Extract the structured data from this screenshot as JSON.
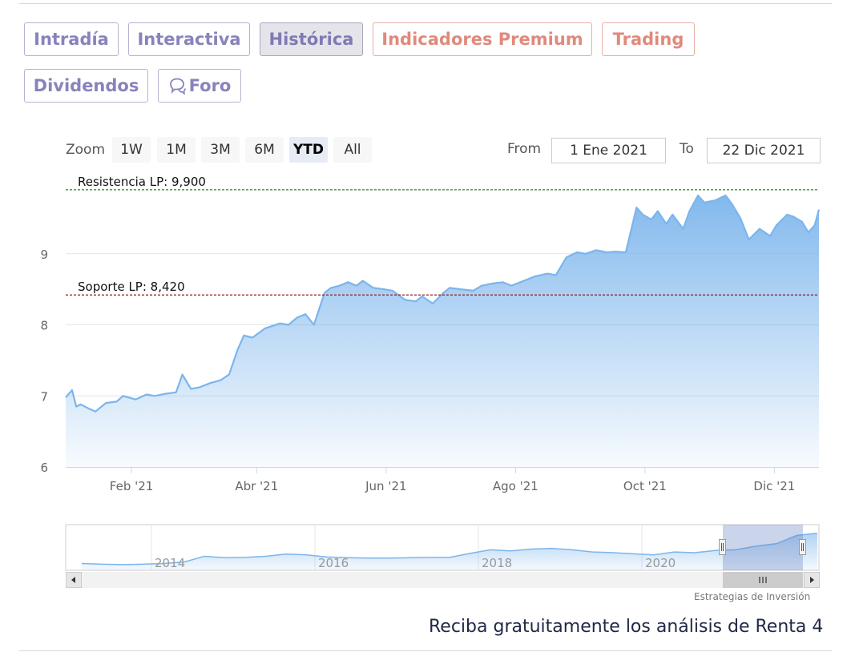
{
  "tabs": [
    {
      "label": "Intradía",
      "state": "normal"
    },
    {
      "label": "Interactiva",
      "state": "normal"
    },
    {
      "label": "Histórica",
      "state": "active"
    },
    {
      "label": "Indicadores Premium",
      "state": "premium"
    },
    {
      "label": "Trading",
      "state": "premium"
    },
    {
      "label": "Dividendos",
      "state": "normal"
    },
    {
      "label": "Foro",
      "state": "normal",
      "icon": "speech-bubbles-icon"
    }
  ],
  "range_selector": {
    "zoom_label": "Zoom",
    "buttons": [
      "1W",
      "1M",
      "3M",
      "6M",
      "YTD",
      "All"
    ],
    "selected": "YTD",
    "from_label": "From",
    "from_value": "1 Ene 2021",
    "to_label": "To",
    "to_value": "22 Dic 2021"
  },
  "chart_data": {
    "type": "area",
    "title": "",
    "x_tick_labels": [
      "Feb '21",
      "Abr '21",
      "Jun '21",
      "Ago '21",
      "Oct '21",
      "Dic '21"
    ],
    "y_tick_labels": [
      "6",
      "7",
      "8",
      "9"
    ],
    "ylim": [
      6,
      10
    ],
    "xlim": [
      "2021-01-01",
      "2021-12-22"
    ],
    "grid": true,
    "annotations": [
      {
        "label": "Resistencia LP: 9,900",
        "value": 9.9,
        "color": "#2e7d32",
        "style": "dashed"
      },
      {
        "label": "Soporte LP: 8,420",
        "value": 8.42,
        "color": "#8b1a1a",
        "style": "dashed"
      }
    ],
    "series": [
      {
        "color": "#7cb5ec",
        "x": [
          "2021-01-01",
          "2021-01-04",
          "2021-01-06",
          "2021-01-08",
          "2021-01-12",
          "2021-01-15",
          "2021-01-20",
          "2021-01-25",
          "2021-01-28",
          "2021-02-03",
          "2021-02-08",
          "2021-02-12",
          "2021-02-17",
          "2021-02-22",
          "2021-02-25",
          "2021-03-01",
          "2021-03-05",
          "2021-03-10",
          "2021-03-15",
          "2021-03-19",
          "2021-03-23",
          "2021-03-26",
          "2021-03-30",
          "2021-04-05",
          "2021-04-08",
          "2021-04-12",
          "2021-04-16",
          "2021-04-20",
          "2021-04-24",
          "2021-04-28",
          "2021-05-03",
          "2021-05-06",
          "2021-05-10",
          "2021-05-14",
          "2021-05-18",
          "2021-05-21",
          "2021-05-26",
          "2021-05-31",
          "2021-06-04",
          "2021-06-10",
          "2021-06-15",
          "2021-06-18",
          "2021-06-23",
          "2021-06-28",
          "2021-07-01",
          "2021-07-06",
          "2021-07-12",
          "2021-07-16",
          "2021-07-21",
          "2021-07-26",
          "2021-07-30",
          "2021-08-05",
          "2021-08-10",
          "2021-08-16",
          "2021-08-20",
          "2021-08-25",
          "2021-08-30",
          "2021-09-03",
          "2021-09-08",
          "2021-09-13",
          "2021-09-17",
          "2021-09-22",
          "2021-09-27",
          "2021-09-30",
          "2021-10-04",
          "2021-10-07",
          "2021-10-11",
          "2021-10-14",
          "2021-10-19",
          "2021-10-22",
          "2021-10-26",
          "2021-10-29",
          "2021-11-03",
          "2021-11-08",
          "2021-11-11",
          "2021-11-15",
          "2021-11-19",
          "2021-11-24",
          "2021-11-29",
          "2021-12-02",
          "2021-12-07",
          "2021-12-10",
          "2021-12-14",
          "2021-12-17",
          "2021-12-20",
          "2021-12-22"
        ],
        "y": [
          6.98,
          7.08,
          6.85,
          6.88,
          6.82,
          6.78,
          6.9,
          6.92,
          7.0,
          6.95,
          7.02,
          7.0,
          7.03,
          7.05,
          7.3,
          7.1,
          7.12,
          7.18,
          7.22,
          7.3,
          7.65,
          7.85,
          7.82,
          7.95,
          7.98,
          8.02,
          8.0,
          8.1,
          8.15,
          8.0,
          8.45,
          8.52,
          8.55,
          8.6,
          8.55,
          8.62,
          8.52,
          8.5,
          8.48,
          8.35,
          8.33,
          8.4,
          8.3,
          8.45,
          8.52,
          8.5,
          8.48,
          8.55,
          8.58,
          8.6,
          8.55,
          8.62,
          8.68,
          8.72,
          8.7,
          8.95,
          9.02,
          9.0,
          9.05,
          9.02,
          9.03,
          9.02,
          9.65,
          9.55,
          9.48,
          9.6,
          9.42,
          9.55,
          9.35,
          9.6,
          9.82,
          9.72,
          9.75,
          9.82,
          9.7,
          9.5,
          9.2,
          9.35,
          9.25,
          9.4,
          9.55,
          9.52,
          9.45,
          9.3,
          9.4,
          9.62
        ]
      }
    ],
    "navigator": {
      "x_tick_labels": [
        "2014",
        "2016",
        "2018",
        "2020"
      ]
    }
  },
  "credit": "Estrategias de Inversión",
  "cta": "Reciba gratuitamente los análisis de Renta 4",
  "colors": {
    "series": "#7cb5ec",
    "tab_text": "#8783bc",
    "premium": "#df8a7c",
    "resistance": "#2e7d32",
    "support": "#8b1a1a"
  }
}
